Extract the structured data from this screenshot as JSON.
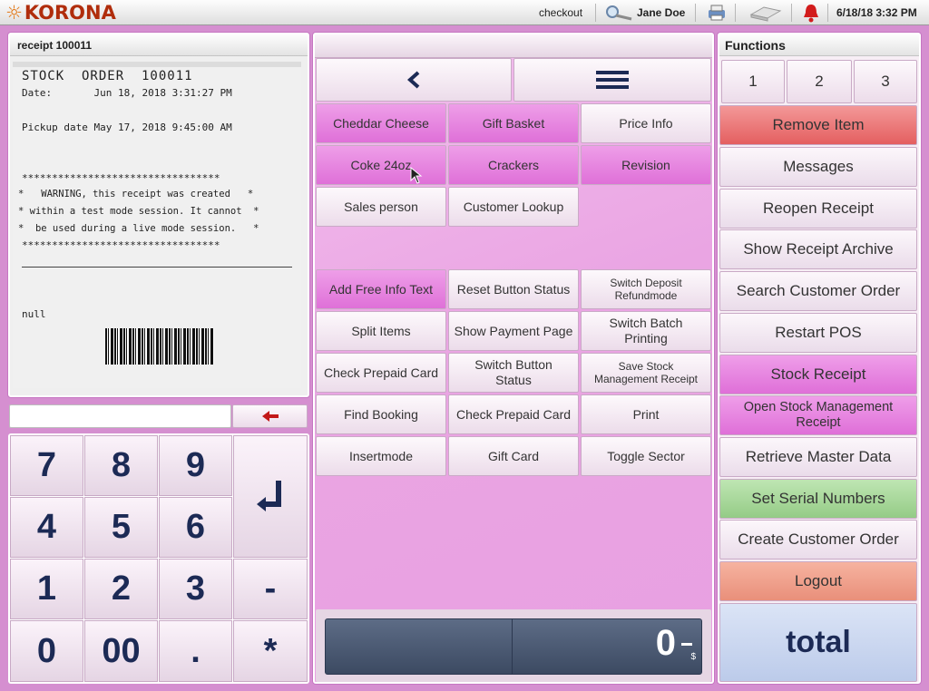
{
  "topbar": {
    "logo": "KORONA",
    "mode": "checkout",
    "user": "Jane Doe",
    "datetime": "6/18/18 3:32 PM"
  },
  "receipt_panel": {
    "title": "receipt 100011",
    "heading": "STOCK  ORDER  100011",
    "date_line": "Date:       Jun 18, 2018 3:31:27 PM",
    "pickup_line": "Pickup date May 17, 2018 9:45:00 AM",
    "stars": "*********************************",
    "warning_lines": [
      "*   WARNING, this receipt was created   *",
      "* within a test mode session. It cannot  *",
      "*  be used during a live mode session.   *"
    ],
    "null_text": "null",
    "input_value": ""
  },
  "keypad": {
    "keys": [
      "7",
      "8",
      "9",
      "4",
      "5",
      "6",
      "1",
      "2",
      "3",
      "0",
      "00",
      ".",
      "-",
      "*"
    ]
  },
  "center": {
    "buttons_top": [
      {
        "label": "Cheddar Cheese",
        "style": "magenta"
      },
      {
        "label": "Gift Basket",
        "style": "magenta"
      },
      {
        "label": "Price Info",
        "style": "light"
      },
      {
        "label": "Coke 24oz",
        "style": "magenta"
      },
      {
        "label": "Crackers",
        "style": "magenta"
      },
      {
        "label": "Revision",
        "style": "magenta"
      },
      {
        "label": "Sales person",
        "style": "light"
      },
      {
        "label": "Customer Lookup",
        "style": "light"
      }
    ],
    "buttons_bottom": [
      {
        "label": "Add Free Info Text",
        "style": "magenta"
      },
      {
        "label": "Reset Button Status",
        "style": "light"
      },
      {
        "label": "Switch Deposit Refundmode",
        "style": "light",
        "small": true
      },
      {
        "label": "Split Items",
        "style": "light"
      },
      {
        "label": "Show Payment Page",
        "style": "light"
      },
      {
        "label": "Switch Batch Printing",
        "style": "light"
      },
      {
        "label": "Check Prepaid Card",
        "style": "light"
      },
      {
        "label": "Switch Button Status",
        "style": "light"
      },
      {
        "label": "Save Stock Management Receipt",
        "style": "light",
        "small": true
      },
      {
        "label": "Find Booking",
        "style": "light"
      },
      {
        "label": "Check Prepaid Card",
        "style": "light"
      },
      {
        "label": "Print",
        "style": "light"
      },
      {
        "label": "Insertmode",
        "style": "light"
      },
      {
        "label": "Gift Card",
        "style": "light"
      },
      {
        "label": "Toggle Sector",
        "style": "light"
      }
    ],
    "total_display": "0",
    "currency": "$"
  },
  "functions": {
    "title": "Functions",
    "tabs": [
      "1",
      "2",
      "3"
    ],
    "buttons": [
      {
        "label": "Remove Item",
        "color": "red"
      },
      {
        "label": "Messages",
        "color": "light"
      },
      {
        "label": "Reopen Receipt",
        "color": "light"
      },
      {
        "label": "Show Receipt Archive",
        "color": "light"
      },
      {
        "label": "Search Customer Order",
        "color": "light"
      },
      {
        "label": "Restart POS",
        "color": "light"
      },
      {
        "label": "Stock Receipt",
        "color": "magenta"
      },
      {
        "label": "Open Stock Management Receipt",
        "color": "magenta"
      },
      {
        "label": "Retrieve Master Data",
        "color": "light"
      },
      {
        "label": "Set Serial Numbers",
        "color": "green"
      },
      {
        "label": "Create Customer Order",
        "color": "light"
      },
      {
        "label": "Logout",
        "color": "salmon"
      }
    ],
    "total_label": "total"
  },
  "colors": {
    "accent_magenta": "#df70d8",
    "remove_red": "#e45f60",
    "serial_green": "#94cb86",
    "logout_salmon": "#e98f7a",
    "total_blue": "#c9d6f0",
    "keypad_text": "#1c2a55"
  },
  "icons": [
    "korona-sun-icon",
    "magnifier-key-icon",
    "printer-icon",
    "cash-drawer-icon",
    "bell-icon",
    "back-chevron-icon",
    "hamburger-menu-icon",
    "backspace-arrow-icon",
    "enter-return-icon",
    "mouse-cursor-icon"
  ]
}
